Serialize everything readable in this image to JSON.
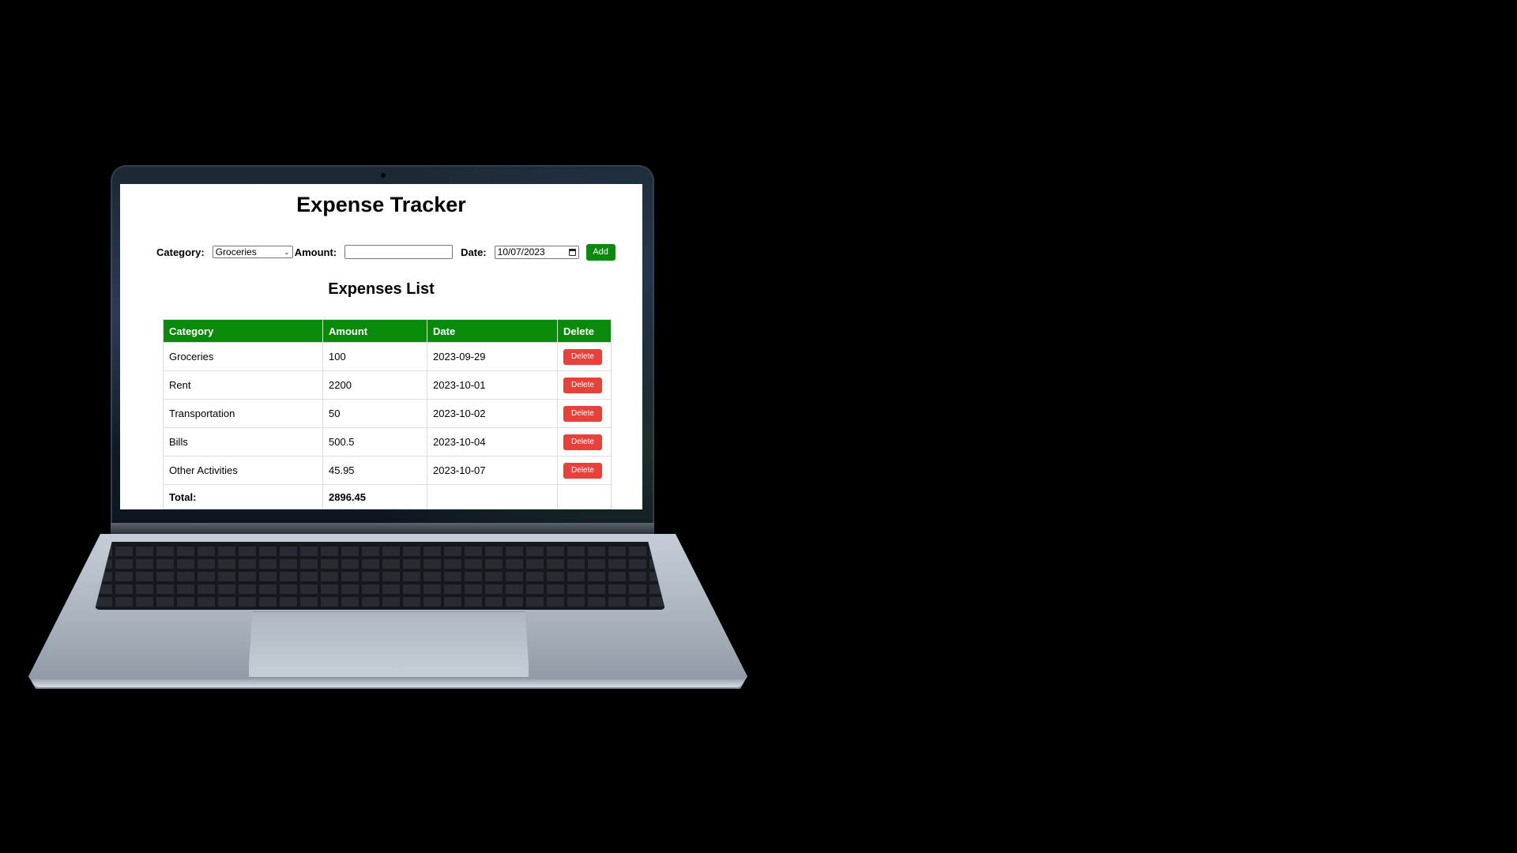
{
  "page": {
    "title": "Expense Tracker"
  },
  "form": {
    "category_label": "Category:",
    "category_value": "Groceries",
    "amount_label": "Amount:",
    "amount_value": "",
    "date_label": "Date:",
    "date_value": "10/07/2023",
    "add_label": "Add"
  },
  "list": {
    "title": "Expenses List",
    "headers": [
      "Category",
      "Amount",
      "Date",
      "Delete"
    ],
    "rows": [
      {
        "category": "Groceries",
        "amount": "100",
        "date": "2023-09-29",
        "action": "Delete"
      },
      {
        "category": "Rent",
        "amount": "2200",
        "date": "2023-10-01",
        "action": "Delete"
      },
      {
        "category": "Transportation",
        "amount": "50",
        "date": "2023-10-02",
        "action": "Delete"
      },
      {
        "category": "Bills",
        "amount": "500.5",
        "date": "2023-10-04",
        "action": "Delete"
      },
      {
        "category": "Other Activities",
        "amount": "45.95",
        "date": "2023-10-07",
        "action": "Delete"
      }
    ],
    "total_label": "Total:",
    "total_value": "2896.45"
  },
  "icons": {
    "select": "chevron-down-icon",
    "date": "calendar-icon"
  },
  "colors": {
    "accent_green": "#0a8a0a",
    "delete_red": "#e8413a",
    "backdrop": "#000000"
  }
}
